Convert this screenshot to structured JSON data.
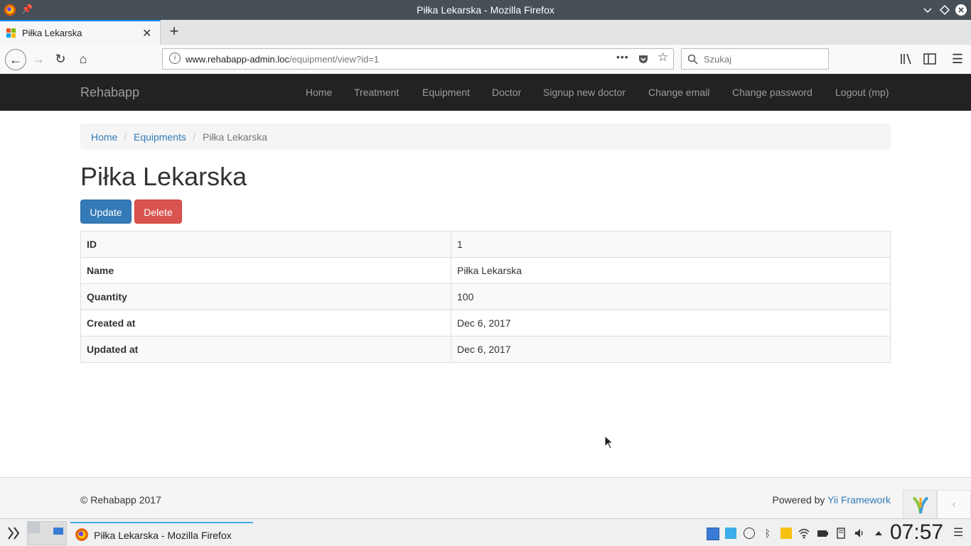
{
  "window": {
    "title": "Piłka Lekarska - Mozilla Firefox"
  },
  "browser": {
    "tab_title": "Piłka Lekarska",
    "url_host": "www.rehabapp-admin.loc",
    "url_path": "/equipment/view?id=1",
    "search_placeholder": "Szukaj"
  },
  "app": {
    "brand": "Rehabapp",
    "menu": [
      "Home",
      "Treatment",
      "Equipment",
      "Doctor",
      "Signup new doctor",
      "Change email",
      "Change password",
      "Logout (mp)"
    ]
  },
  "breadcrumb": {
    "home": "Home",
    "section": "Equipments",
    "current": "Piłka Lekarska",
    "separator": "/"
  },
  "page": {
    "title": "Piłka Lekarska",
    "update_label": "Update",
    "delete_label": "Delete"
  },
  "detail": [
    {
      "label": "ID",
      "value": "1"
    },
    {
      "label": "Name",
      "value": "Piłka Lekarska"
    },
    {
      "label": "Quantity",
      "value": "100"
    },
    {
      "label": "Created at",
      "value": "Dec 6, 2017"
    },
    {
      "label": "Updated at",
      "value": "Dec 6, 2017"
    }
  ],
  "footer": {
    "copyright": "© Rehabapp 2017",
    "powered_prefix": "Powered by ",
    "powered_link": "Yii Framework"
  },
  "taskbar": {
    "task_label": "Piłka Lekarska - Mozilla Firefox",
    "clock": "07:57"
  },
  "colors": {
    "primary": "#337ab7",
    "danger": "#d9534f",
    "navbar": "#222222"
  }
}
